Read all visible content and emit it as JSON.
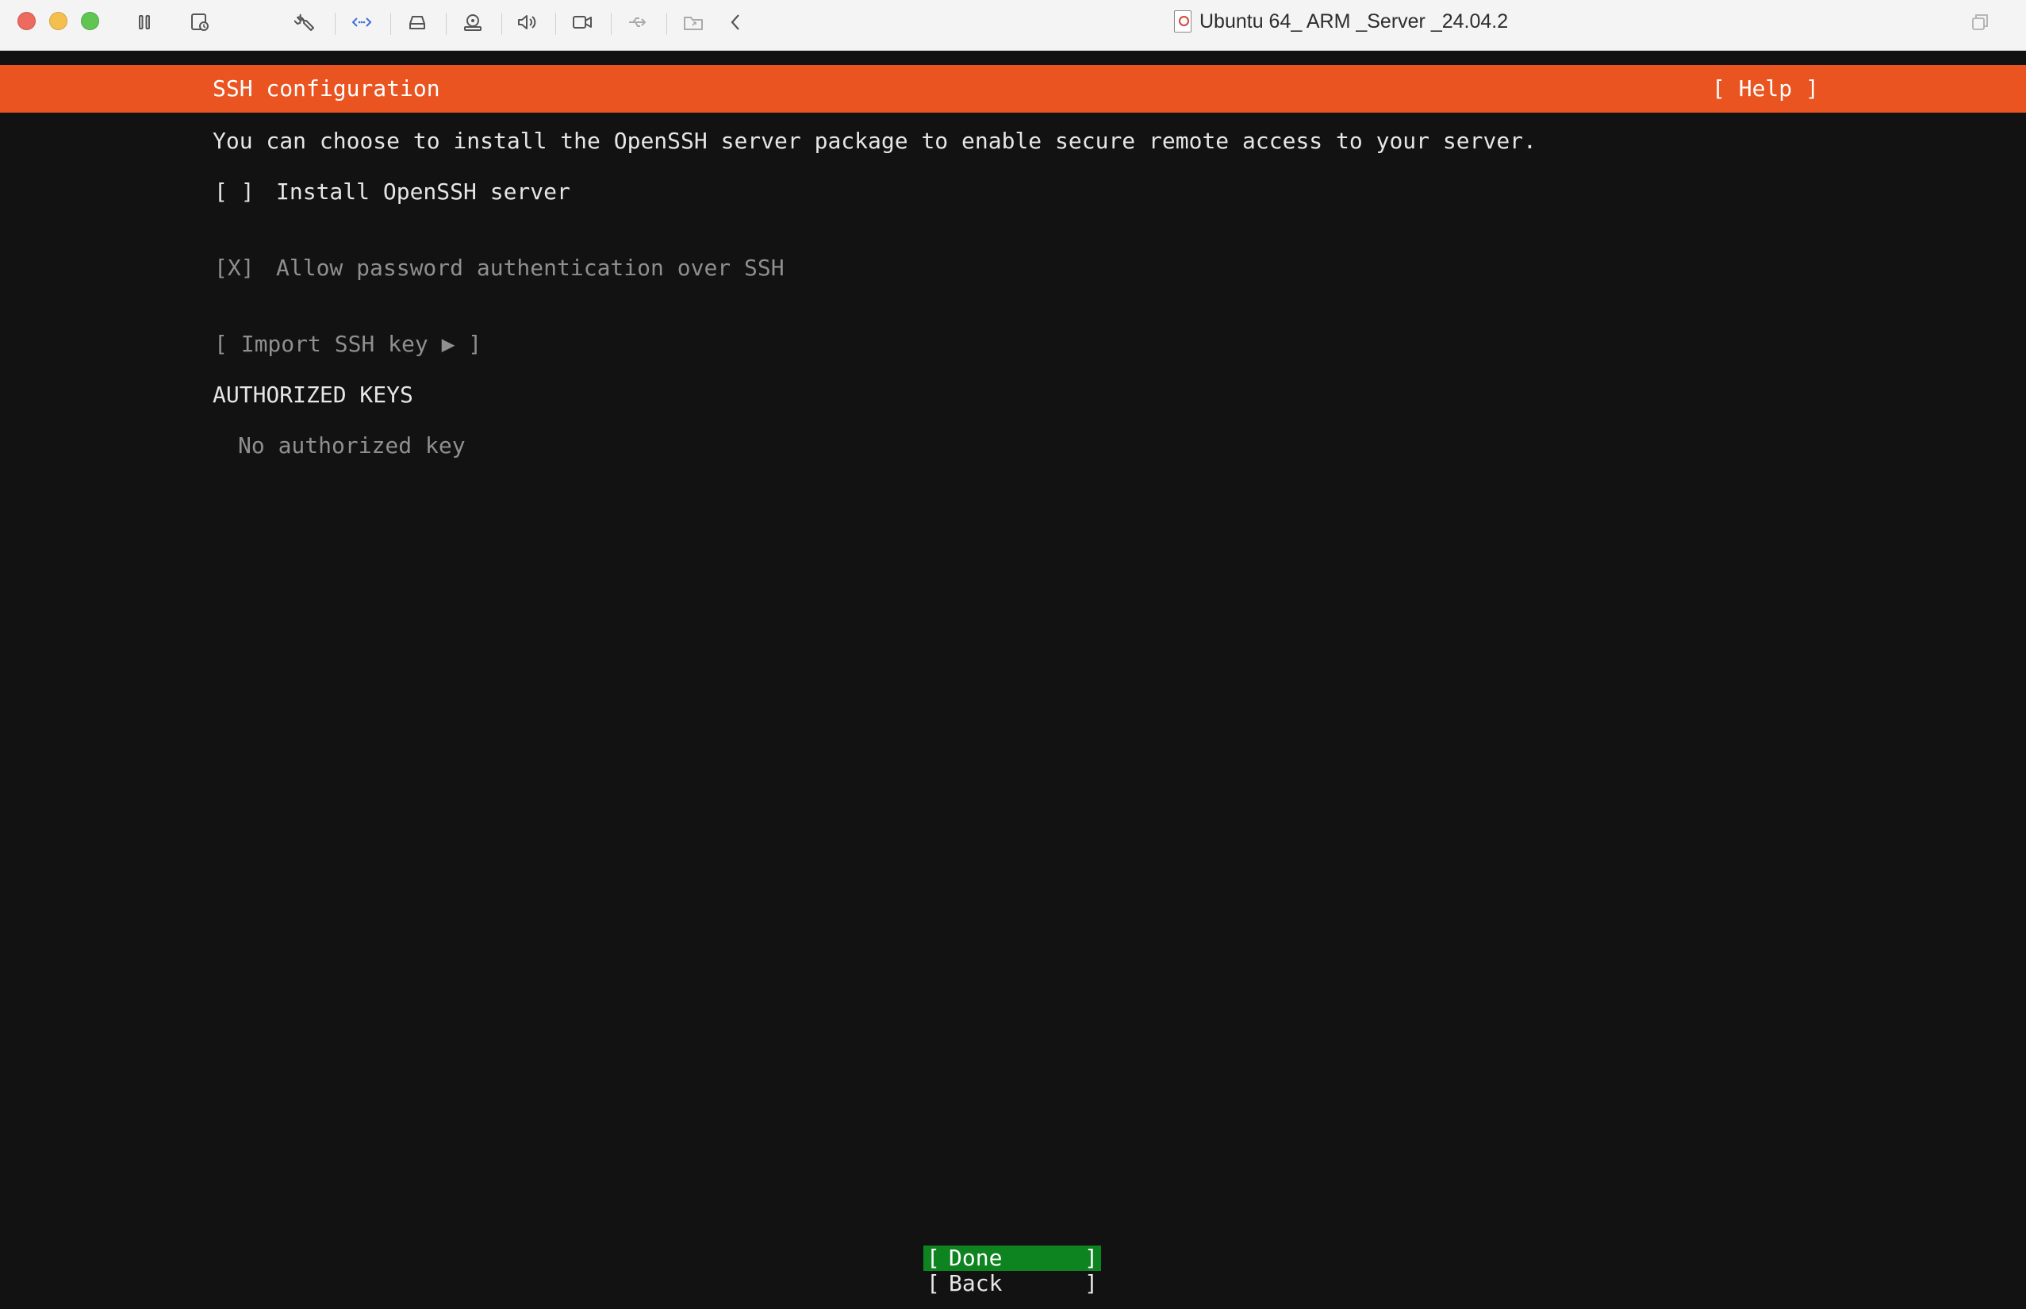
{
  "window": {
    "title": "Ubuntu 64_ ARM _Server _24.04.2",
    "toolbar_icons": [
      "pause-icon",
      "snapshot-icon",
      "settings-wrench-icon",
      "network-arrows-icon",
      "hard-disk-icon",
      "cd-dvd-icon",
      "sound-icon",
      "camera-icon",
      "usb-icon",
      "shared-folder-icon",
      "chevron-left-icon"
    ]
  },
  "installer": {
    "header_title": "SSH configuration",
    "help_label": "[ Help ]",
    "intro": "You can choose to install the OpenSSH server package to enable secure remote access to your server.",
    "openssh": {
      "checkbox": "[ ]",
      "label": "Install OpenSSH server",
      "checked": false
    },
    "password_auth": {
      "checkbox": "[X]",
      "label": "Allow password authentication over SSH",
      "checked": true,
      "enabled": false
    },
    "import_ssh_key": "[ Import SSH key ▶ ]",
    "authorized_keys_heading": "AUTHORIZED KEYS",
    "no_keys_text": "No authorized key",
    "buttons": {
      "done": {
        "left": "[",
        "label": "Done",
        "right": "]"
      },
      "back": {
        "left": "[",
        "label": "Back",
        "right": "]"
      }
    }
  },
  "colors": {
    "ubuntu_orange": "#e95420",
    "focus_green": "#0e8420",
    "terminal_bg": "#121212",
    "text": "#e6e6e6",
    "dim_text": "#8f8f8f"
  }
}
